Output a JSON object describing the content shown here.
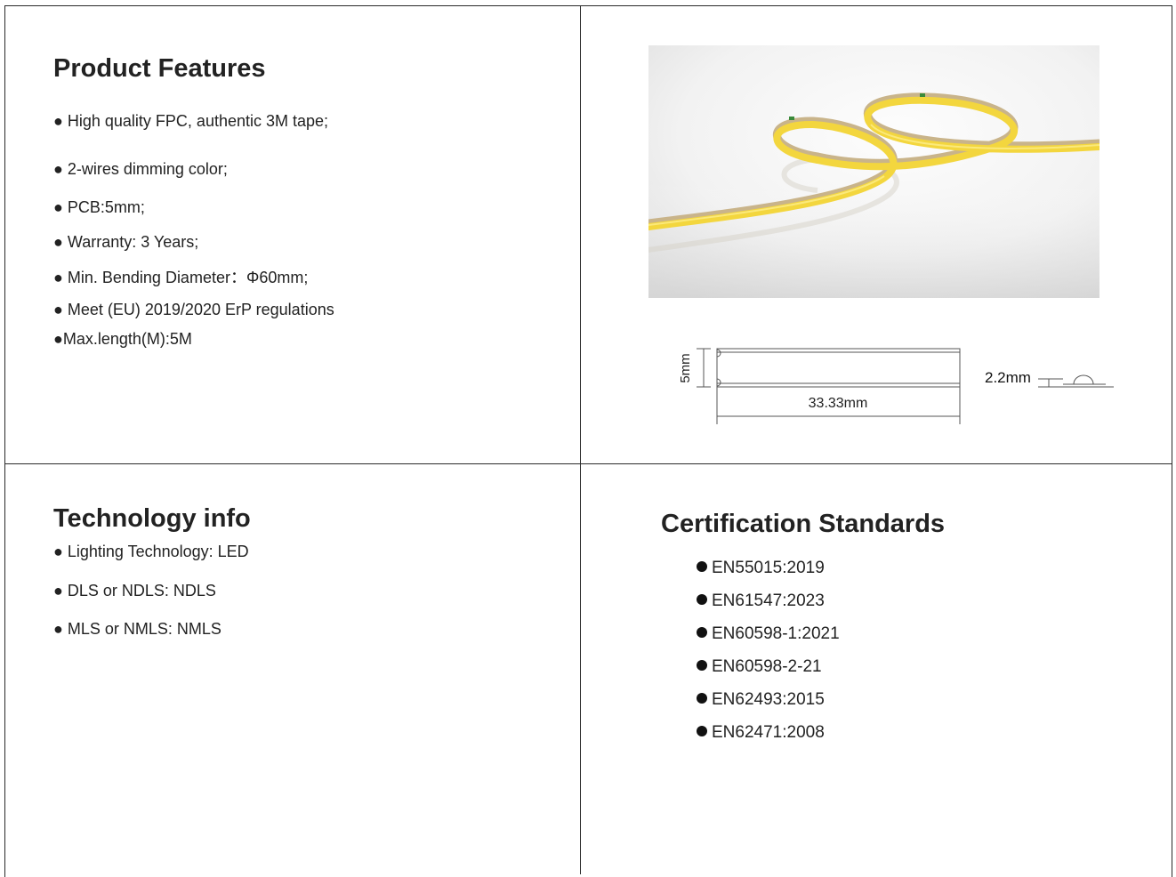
{
  "product_features": {
    "title": "Product Features",
    "items": [
      "● High quality FPC, authentic 3M tape;",
      "● 2-wires dimming color;",
      "● PCB:5mm;",
      "● Warranty: 3 Years;",
      "● Min. Bending Diameter：Φ60mm;",
      "● Meet (EU) 2019/2020 ErP regulations",
      "●Max.length(M):5M"
    ]
  },
  "technology_info": {
    "title": "Technology info",
    "items": [
      "● Lighting Technology: LED",
      "● DLS or NDLS: NDLS",
      "● MLS or NMLS: NMLS"
    ]
  },
  "certification": {
    "title": "Certification Standards",
    "items": [
      "EN55015:2019",
      "EN61547:2023",
      "EN60598-1:2021",
      "EN60598-2-21",
      "EN62493:2015",
      "EN62471:2008"
    ]
  },
  "dimension_diagram": {
    "height_label": "5mm",
    "length_label": "33.33mm",
    "thickness_label": "2.2mm"
  }
}
